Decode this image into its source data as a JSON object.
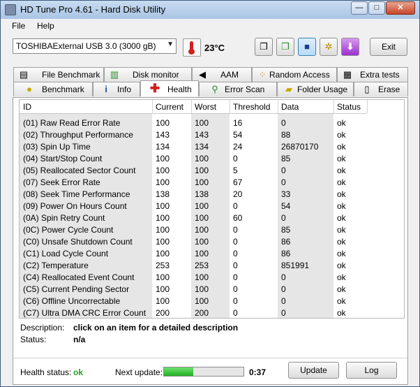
{
  "window": {
    "title": "HD Tune Pro 4.61 - Hard Disk Utility",
    "controls": [
      "—",
      "□",
      "✕"
    ]
  },
  "menu": {
    "file": "File",
    "help": "Help"
  },
  "toolbar": {
    "drive": "TOSHIBAExternal USB 3.0 (3000 gB)",
    "temperature": "23°C",
    "exit": "Exit"
  },
  "tabs_top": [
    {
      "label": "File Benchmark",
      "icon": "file-benchmark-icon"
    },
    {
      "label": "Disk monitor",
      "icon": "disk-monitor-icon"
    },
    {
      "label": "AAM",
      "icon": "speaker-icon"
    },
    {
      "label": "Random Access",
      "icon": "random-access-icon"
    },
    {
      "label": "Extra tests",
      "icon": "extra-tests-icon"
    }
  ],
  "tabs_bottom": [
    {
      "label": "Benchmark",
      "icon": "lightbulb-icon"
    },
    {
      "label": "Info",
      "icon": "info-icon"
    },
    {
      "label": "Health",
      "icon": "red-cross-icon"
    },
    {
      "label": "Error Scan",
      "icon": "magnifier-icon"
    },
    {
      "label": "Folder Usage",
      "icon": "folder-icon"
    },
    {
      "label": "Erase",
      "icon": "trash-icon"
    }
  ],
  "table": {
    "headers": [
      "ID",
      "Current",
      "Worst",
      "Threshold",
      "Data",
      "Status"
    ],
    "rows": [
      [
        "(01) Raw Read Error Rate",
        "100",
        "100",
        "16",
        "0",
        "ok"
      ],
      [
        "(02) Throughput Performance",
        "143",
        "143",
        "54",
        "88",
        "ok"
      ],
      [
        "(03) Spin Up Time",
        "134",
        "134",
        "24",
        "26870170",
        "ok"
      ],
      [
        "(04) Start/Stop Count",
        "100",
        "100",
        "0",
        "85",
        "ok"
      ],
      [
        "(05) Reallocated Sector Count",
        "100",
        "100",
        "5",
        "0",
        "ok"
      ],
      [
        "(07) Seek Error Rate",
        "100",
        "100",
        "67",
        "0",
        "ok"
      ],
      [
        "(08) Seek Time Performance",
        "138",
        "138",
        "20",
        "33",
        "ok"
      ],
      [
        "(09) Power On Hours Count",
        "100",
        "100",
        "0",
        "54",
        "ok"
      ],
      [
        "(0A) Spin Retry Count",
        "100",
        "100",
        "60",
        "0",
        "ok"
      ],
      [
        "(0C) Power Cycle Count",
        "100",
        "100",
        "0",
        "85",
        "ok"
      ],
      [
        "(C0) Unsafe Shutdown Count",
        "100",
        "100",
        "0",
        "86",
        "ok"
      ],
      [
        "(C1) Load Cycle Count",
        "100",
        "100",
        "0",
        "86",
        "ok"
      ],
      [
        "(C2) Temperature",
        "253",
        "253",
        "0",
        "851991",
        "ok"
      ],
      [
        "(C4) Reallocated Event Count",
        "100",
        "100",
        "0",
        "0",
        "ok"
      ],
      [
        "(C5) Current Pending Sector",
        "100",
        "100",
        "0",
        "0",
        "ok"
      ],
      [
        "(C6) Offline Uncorrectable",
        "100",
        "100",
        "0",
        "0",
        "ok"
      ],
      [
        "(C7) Ultra DMA CRC Error Count",
        "200",
        "200",
        "0",
        "0",
        "ok"
      ]
    ]
  },
  "details": {
    "description_label": "Description:",
    "description_value": "click on an item for a detailed description",
    "status_label": "Status:",
    "status_value": "n/a"
  },
  "footer": {
    "health_label": "Health status:",
    "health_value": "ok",
    "next_update_label": "Next update:",
    "countdown": "0:37",
    "progress_fraction": 0.37,
    "update": "Update",
    "log": "Log"
  },
  "colors": {
    "ok_green": "#22a022",
    "title_gradient_top": "#c9dcf2",
    "grey_column": "#e6e6e6"
  }
}
